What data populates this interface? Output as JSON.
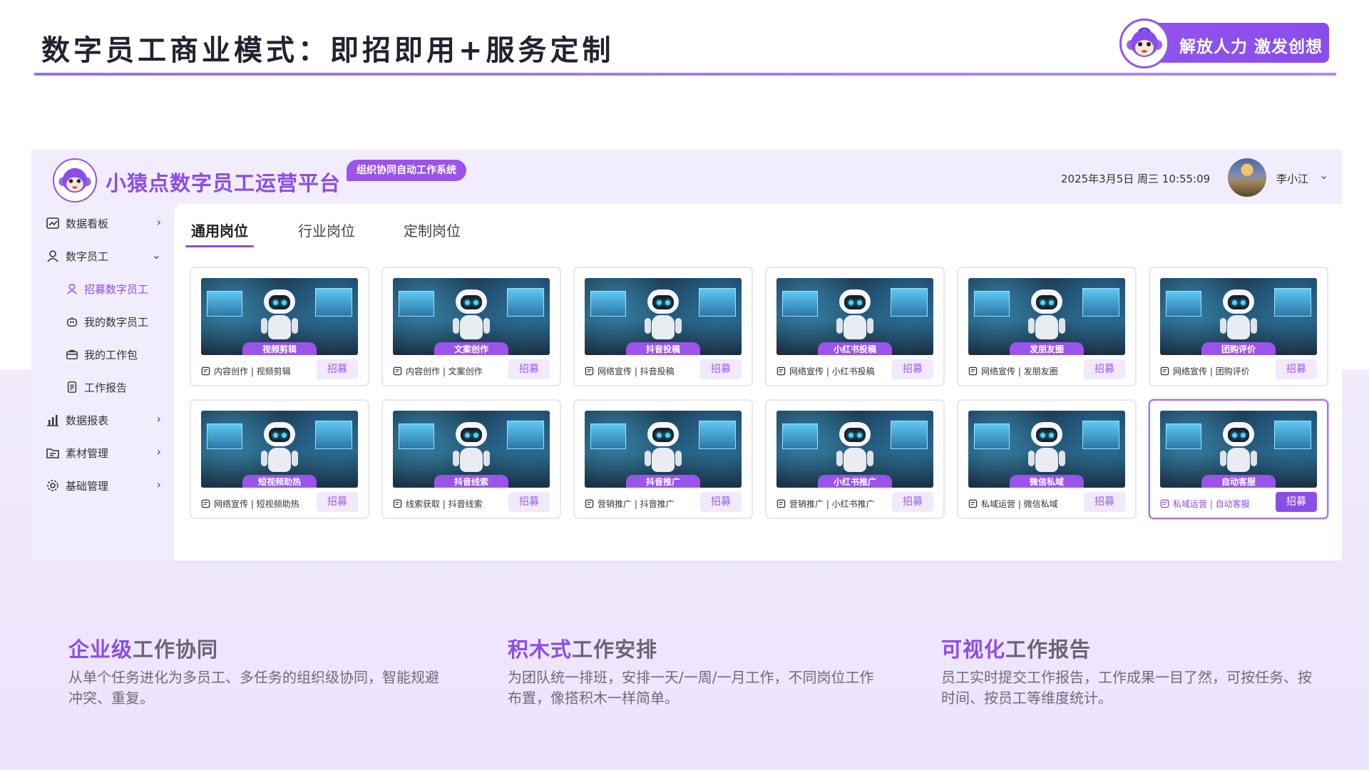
{
  "slide": {
    "title": "数字员工商业模式：即招即用+服务定制",
    "slogan": "解放人力 激发创想"
  },
  "app": {
    "name": "小猿点数字员工运营平台",
    "tag": "组织协同自动工作系统",
    "datetime": "2025年3月5日 周三 10:55:09",
    "user": "李小江"
  },
  "sidebar": {
    "items": [
      {
        "label": "数据看板",
        "icon": "dashboard-icon",
        "caret": "›"
      },
      {
        "label": "数字员工",
        "icon": "person-icon",
        "caret": "⌄"
      },
      {
        "label": "招募数字员工",
        "icon": "person-icon",
        "active": true
      },
      {
        "label": "我的数字员工",
        "icon": "robot-icon"
      },
      {
        "label": "我的工作包",
        "icon": "briefcase-icon"
      },
      {
        "label": "工作报告",
        "icon": "report-icon"
      },
      {
        "label": "数据报表",
        "icon": "bar-chart-icon",
        "caret": "›"
      },
      {
        "label": "素材管理",
        "icon": "folder-icon",
        "caret": "›"
      },
      {
        "label": "基础管理",
        "icon": "gear-icon",
        "caret": "›"
      }
    ]
  },
  "tabs": [
    {
      "label": "通用岗位",
      "active": true
    },
    {
      "label": "行业岗位"
    },
    {
      "label": "定制岗位"
    }
  ],
  "recruit_label": "招募",
  "cards": [
    {
      "title": "视频剪辑",
      "meta": "内容创作 | 视频剪辑"
    },
    {
      "title": "文案创作",
      "meta": "内容创作 | 文案创作"
    },
    {
      "title": "抖音投稿",
      "meta": "网络宣传 | 抖音投稿"
    },
    {
      "title": "小红书投稿",
      "meta": "网络宣传 | 小红书投稿"
    },
    {
      "title": "发朋友圈",
      "meta": "网络宣传 | 发朋友圈"
    },
    {
      "title": "团购评价",
      "meta": "网络宣传 | 团购评价"
    },
    {
      "title": "短视频助热",
      "meta": "网络宣传 | 短视频助热"
    },
    {
      "title": "抖音线索",
      "meta": "线索获取 | 抖音线索"
    },
    {
      "title": "抖音推广",
      "meta": "营销推广 | 抖音推广"
    },
    {
      "title": "小红书推广",
      "meta": "营销推广 | 小红书推广"
    },
    {
      "title": "微信私域",
      "meta": "私域运营 | 微信私域"
    },
    {
      "title": "自动客服",
      "meta": "私域运营 | 自动客服",
      "selected": true
    }
  ],
  "features": [
    {
      "highlight": "企业级",
      "rest": "工作协同",
      "desc": "从单个任务进化为多员工、多任务的组织级协同，智能规避冲突、重复。"
    },
    {
      "highlight": "积木式",
      "rest": "工作安排",
      "desc": "为团队统一排班，安排一天/一周/一月工作，不同岗位工作布置，像搭积木一样简单。"
    },
    {
      "highlight": "可视化",
      "rest": "工作报告",
      "desc": "员工实时提交工作报告，工作成果一目了然，可按任务、按时间、按员工等维度统计。"
    }
  ],
  "colors": {
    "accent": "#8b4de9",
    "accent_light": "#f1e9fd"
  }
}
